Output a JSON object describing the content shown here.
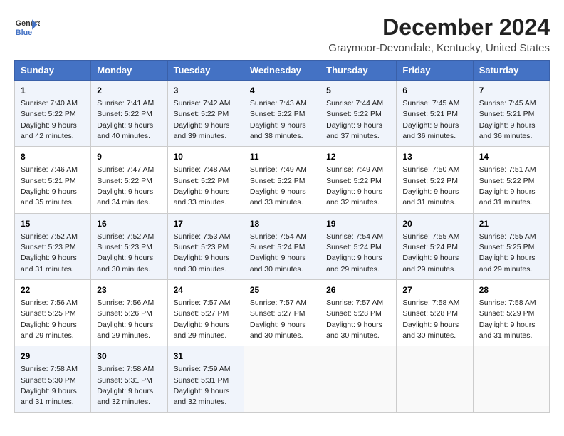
{
  "header": {
    "logo_line1": "General",
    "logo_line2": "Blue",
    "title": "December 2024",
    "subtitle": "Graymoor-Devondale, Kentucky, United States"
  },
  "columns": [
    "Sunday",
    "Monday",
    "Tuesday",
    "Wednesday",
    "Thursday",
    "Friday",
    "Saturday"
  ],
  "weeks": [
    [
      {
        "day": "1",
        "sunrise": "Sunrise: 7:40 AM",
        "sunset": "Sunset: 5:22 PM",
        "daylight": "Daylight: 9 hours and 42 minutes."
      },
      {
        "day": "2",
        "sunrise": "Sunrise: 7:41 AM",
        "sunset": "Sunset: 5:22 PM",
        "daylight": "Daylight: 9 hours and 40 minutes."
      },
      {
        "day": "3",
        "sunrise": "Sunrise: 7:42 AM",
        "sunset": "Sunset: 5:22 PM",
        "daylight": "Daylight: 9 hours and 39 minutes."
      },
      {
        "day": "4",
        "sunrise": "Sunrise: 7:43 AM",
        "sunset": "Sunset: 5:22 PM",
        "daylight": "Daylight: 9 hours and 38 minutes."
      },
      {
        "day": "5",
        "sunrise": "Sunrise: 7:44 AM",
        "sunset": "Sunset: 5:22 PM",
        "daylight": "Daylight: 9 hours and 37 minutes."
      },
      {
        "day": "6",
        "sunrise": "Sunrise: 7:45 AM",
        "sunset": "Sunset: 5:21 PM",
        "daylight": "Daylight: 9 hours and 36 minutes."
      },
      {
        "day": "7",
        "sunrise": "Sunrise: 7:45 AM",
        "sunset": "Sunset: 5:21 PM",
        "daylight": "Daylight: 9 hours and 36 minutes."
      }
    ],
    [
      {
        "day": "8",
        "sunrise": "Sunrise: 7:46 AM",
        "sunset": "Sunset: 5:21 PM",
        "daylight": "Daylight: 9 hours and 35 minutes."
      },
      {
        "day": "9",
        "sunrise": "Sunrise: 7:47 AM",
        "sunset": "Sunset: 5:22 PM",
        "daylight": "Daylight: 9 hours and 34 minutes."
      },
      {
        "day": "10",
        "sunrise": "Sunrise: 7:48 AM",
        "sunset": "Sunset: 5:22 PM",
        "daylight": "Daylight: 9 hours and 33 minutes."
      },
      {
        "day": "11",
        "sunrise": "Sunrise: 7:49 AM",
        "sunset": "Sunset: 5:22 PM",
        "daylight": "Daylight: 9 hours and 33 minutes."
      },
      {
        "day": "12",
        "sunrise": "Sunrise: 7:49 AM",
        "sunset": "Sunset: 5:22 PM",
        "daylight": "Daylight: 9 hours and 32 minutes."
      },
      {
        "day": "13",
        "sunrise": "Sunrise: 7:50 AM",
        "sunset": "Sunset: 5:22 PM",
        "daylight": "Daylight: 9 hours and 31 minutes."
      },
      {
        "day": "14",
        "sunrise": "Sunrise: 7:51 AM",
        "sunset": "Sunset: 5:22 PM",
        "daylight": "Daylight: 9 hours and 31 minutes."
      }
    ],
    [
      {
        "day": "15",
        "sunrise": "Sunrise: 7:52 AM",
        "sunset": "Sunset: 5:23 PM",
        "daylight": "Daylight: 9 hours and 31 minutes."
      },
      {
        "day": "16",
        "sunrise": "Sunrise: 7:52 AM",
        "sunset": "Sunset: 5:23 PM",
        "daylight": "Daylight: 9 hours and 30 minutes."
      },
      {
        "day": "17",
        "sunrise": "Sunrise: 7:53 AM",
        "sunset": "Sunset: 5:23 PM",
        "daylight": "Daylight: 9 hours and 30 minutes."
      },
      {
        "day": "18",
        "sunrise": "Sunrise: 7:54 AM",
        "sunset": "Sunset: 5:24 PM",
        "daylight": "Daylight: 9 hours and 30 minutes."
      },
      {
        "day": "19",
        "sunrise": "Sunrise: 7:54 AM",
        "sunset": "Sunset: 5:24 PM",
        "daylight": "Daylight: 9 hours and 29 minutes."
      },
      {
        "day": "20",
        "sunrise": "Sunrise: 7:55 AM",
        "sunset": "Sunset: 5:24 PM",
        "daylight": "Daylight: 9 hours and 29 minutes."
      },
      {
        "day": "21",
        "sunrise": "Sunrise: 7:55 AM",
        "sunset": "Sunset: 5:25 PM",
        "daylight": "Daylight: 9 hours and 29 minutes."
      }
    ],
    [
      {
        "day": "22",
        "sunrise": "Sunrise: 7:56 AM",
        "sunset": "Sunset: 5:25 PM",
        "daylight": "Daylight: 9 hours and 29 minutes."
      },
      {
        "day": "23",
        "sunrise": "Sunrise: 7:56 AM",
        "sunset": "Sunset: 5:26 PM",
        "daylight": "Daylight: 9 hours and 29 minutes."
      },
      {
        "day": "24",
        "sunrise": "Sunrise: 7:57 AM",
        "sunset": "Sunset: 5:27 PM",
        "daylight": "Daylight: 9 hours and 29 minutes."
      },
      {
        "day": "25",
        "sunrise": "Sunrise: 7:57 AM",
        "sunset": "Sunset: 5:27 PM",
        "daylight": "Daylight: 9 hours and 30 minutes."
      },
      {
        "day": "26",
        "sunrise": "Sunrise: 7:57 AM",
        "sunset": "Sunset: 5:28 PM",
        "daylight": "Daylight: 9 hours and 30 minutes."
      },
      {
        "day": "27",
        "sunrise": "Sunrise: 7:58 AM",
        "sunset": "Sunset: 5:28 PM",
        "daylight": "Daylight: 9 hours and 30 minutes."
      },
      {
        "day": "28",
        "sunrise": "Sunrise: 7:58 AM",
        "sunset": "Sunset: 5:29 PM",
        "daylight": "Daylight: 9 hours and 31 minutes."
      }
    ],
    [
      {
        "day": "29",
        "sunrise": "Sunrise: 7:58 AM",
        "sunset": "Sunset: 5:30 PM",
        "daylight": "Daylight: 9 hours and 31 minutes."
      },
      {
        "day": "30",
        "sunrise": "Sunrise: 7:58 AM",
        "sunset": "Sunset: 5:31 PM",
        "daylight": "Daylight: 9 hours and 32 minutes."
      },
      {
        "day": "31",
        "sunrise": "Sunrise: 7:59 AM",
        "sunset": "Sunset: 5:31 PM",
        "daylight": "Daylight: 9 hours and 32 minutes."
      },
      null,
      null,
      null,
      null
    ]
  ]
}
